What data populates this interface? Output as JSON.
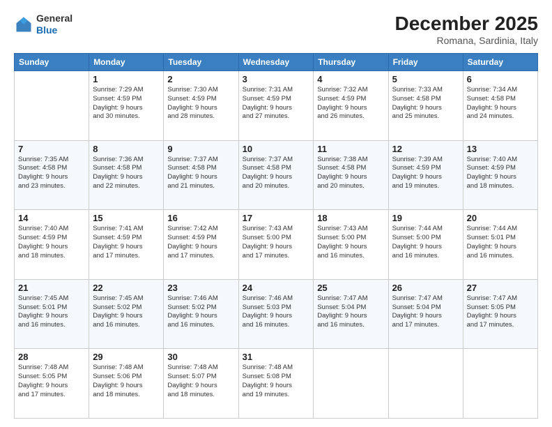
{
  "header": {
    "logo_line1": "General",
    "logo_line2": "Blue",
    "month": "December 2025",
    "location": "Romana, Sardinia, Italy"
  },
  "columns": [
    "Sunday",
    "Monday",
    "Tuesday",
    "Wednesday",
    "Thursday",
    "Friday",
    "Saturday"
  ],
  "weeks": [
    [
      {
        "day": "",
        "info": ""
      },
      {
        "day": "1",
        "info": "Sunrise: 7:29 AM\nSunset: 4:59 PM\nDaylight: 9 hours\nand 30 minutes."
      },
      {
        "day": "2",
        "info": "Sunrise: 7:30 AM\nSunset: 4:59 PM\nDaylight: 9 hours\nand 28 minutes."
      },
      {
        "day": "3",
        "info": "Sunrise: 7:31 AM\nSunset: 4:59 PM\nDaylight: 9 hours\nand 27 minutes."
      },
      {
        "day": "4",
        "info": "Sunrise: 7:32 AM\nSunset: 4:59 PM\nDaylight: 9 hours\nand 26 minutes."
      },
      {
        "day": "5",
        "info": "Sunrise: 7:33 AM\nSunset: 4:58 PM\nDaylight: 9 hours\nand 25 minutes."
      },
      {
        "day": "6",
        "info": "Sunrise: 7:34 AM\nSunset: 4:58 PM\nDaylight: 9 hours\nand 24 minutes."
      }
    ],
    [
      {
        "day": "7",
        "info": "Sunrise: 7:35 AM\nSunset: 4:58 PM\nDaylight: 9 hours\nand 23 minutes."
      },
      {
        "day": "8",
        "info": "Sunrise: 7:36 AM\nSunset: 4:58 PM\nDaylight: 9 hours\nand 22 minutes."
      },
      {
        "day": "9",
        "info": "Sunrise: 7:37 AM\nSunset: 4:58 PM\nDaylight: 9 hours\nand 21 minutes."
      },
      {
        "day": "10",
        "info": "Sunrise: 7:37 AM\nSunset: 4:58 PM\nDaylight: 9 hours\nand 20 minutes."
      },
      {
        "day": "11",
        "info": "Sunrise: 7:38 AM\nSunset: 4:58 PM\nDaylight: 9 hours\nand 20 minutes."
      },
      {
        "day": "12",
        "info": "Sunrise: 7:39 AM\nSunset: 4:59 PM\nDaylight: 9 hours\nand 19 minutes."
      },
      {
        "day": "13",
        "info": "Sunrise: 7:40 AM\nSunset: 4:59 PM\nDaylight: 9 hours\nand 18 minutes."
      }
    ],
    [
      {
        "day": "14",
        "info": "Sunrise: 7:40 AM\nSunset: 4:59 PM\nDaylight: 9 hours\nand 18 minutes."
      },
      {
        "day": "15",
        "info": "Sunrise: 7:41 AM\nSunset: 4:59 PM\nDaylight: 9 hours\nand 17 minutes."
      },
      {
        "day": "16",
        "info": "Sunrise: 7:42 AM\nSunset: 4:59 PM\nDaylight: 9 hours\nand 17 minutes."
      },
      {
        "day": "17",
        "info": "Sunrise: 7:43 AM\nSunset: 5:00 PM\nDaylight: 9 hours\nand 17 minutes."
      },
      {
        "day": "18",
        "info": "Sunrise: 7:43 AM\nSunset: 5:00 PM\nDaylight: 9 hours\nand 16 minutes."
      },
      {
        "day": "19",
        "info": "Sunrise: 7:44 AM\nSunset: 5:00 PM\nDaylight: 9 hours\nand 16 minutes."
      },
      {
        "day": "20",
        "info": "Sunrise: 7:44 AM\nSunset: 5:01 PM\nDaylight: 9 hours\nand 16 minutes."
      }
    ],
    [
      {
        "day": "21",
        "info": "Sunrise: 7:45 AM\nSunset: 5:01 PM\nDaylight: 9 hours\nand 16 minutes."
      },
      {
        "day": "22",
        "info": "Sunrise: 7:45 AM\nSunset: 5:02 PM\nDaylight: 9 hours\nand 16 minutes."
      },
      {
        "day": "23",
        "info": "Sunrise: 7:46 AM\nSunset: 5:02 PM\nDaylight: 9 hours\nand 16 minutes."
      },
      {
        "day": "24",
        "info": "Sunrise: 7:46 AM\nSunset: 5:03 PM\nDaylight: 9 hours\nand 16 minutes."
      },
      {
        "day": "25",
        "info": "Sunrise: 7:47 AM\nSunset: 5:04 PM\nDaylight: 9 hours\nand 16 minutes."
      },
      {
        "day": "26",
        "info": "Sunrise: 7:47 AM\nSunset: 5:04 PM\nDaylight: 9 hours\nand 17 minutes."
      },
      {
        "day": "27",
        "info": "Sunrise: 7:47 AM\nSunset: 5:05 PM\nDaylight: 9 hours\nand 17 minutes."
      }
    ],
    [
      {
        "day": "28",
        "info": "Sunrise: 7:48 AM\nSunset: 5:05 PM\nDaylight: 9 hours\nand 17 minutes."
      },
      {
        "day": "29",
        "info": "Sunrise: 7:48 AM\nSunset: 5:06 PM\nDaylight: 9 hours\nand 18 minutes."
      },
      {
        "day": "30",
        "info": "Sunrise: 7:48 AM\nSunset: 5:07 PM\nDaylight: 9 hours\nand 18 minutes."
      },
      {
        "day": "31",
        "info": "Sunrise: 7:48 AM\nSunset: 5:08 PM\nDaylight: 9 hours\nand 19 minutes."
      },
      {
        "day": "",
        "info": ""
      },
      {
        "day": "",
        "info": ""
      },
      {
        "day": "",
        "info": ""
      }
    ]
  ]
}
